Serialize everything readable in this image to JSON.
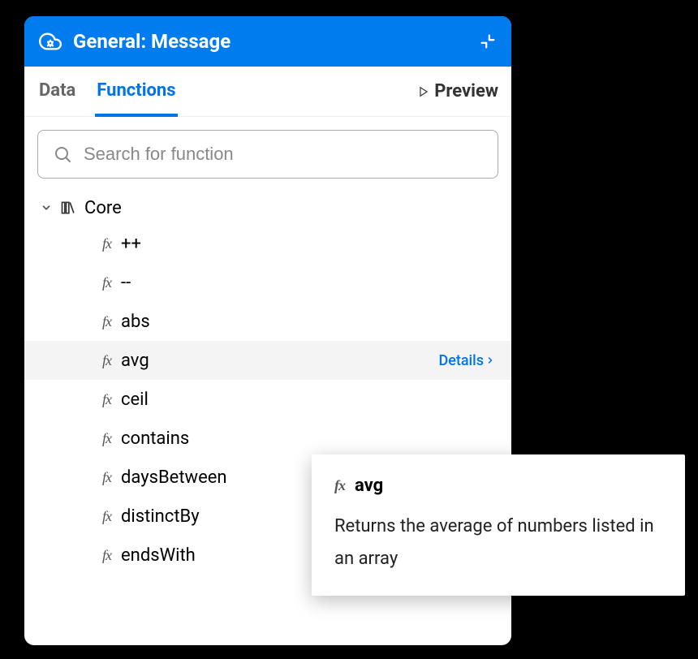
{
  "header": {
    "title": "General: Message"
  },
  "tabs": {
    "data": "Data",
    "functions": "Functions",
    "preview": "Preview"
  },
  "search": {
    "placeholder": "Search for function"
  },
  "category": {
    "name": "Core"
  },
  "functions": [
    {
      "name": "++"
    },
    {
      "name": "--"
    },
    {
      "name": "abs"
    },
    {
      "name": "avg",
      "hovered": true
    },
    {
      "name": "ceil"
    },
    {
      "name": "contains"
    },
    {
      "name": "daysBetween"
    },
    {
      "name": "distinctBy"
    },
    {
      "name": "endsWith"
    }
  ],
  "details_label": "Details",
  "tooltip": {
    "fn": "avg",
    "description": "Returns the average of numbers listed in an array"
  }
}
